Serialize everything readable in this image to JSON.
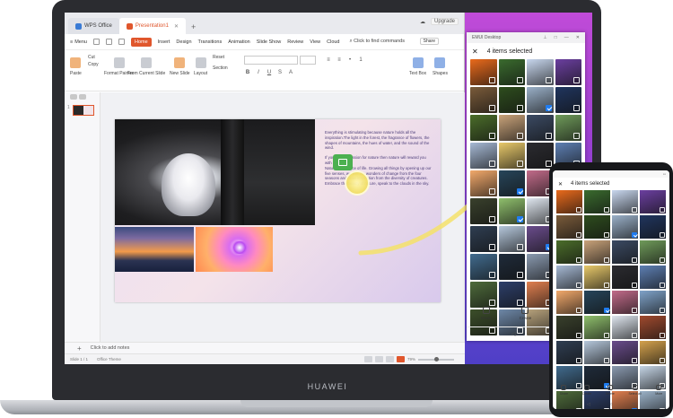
{
  "laptop": {
    "brand": "HUAWEI"
  },
  "wps": {
    "tabs": [
      {
        "label": "WPS Office"
      },
      {
        "label": "Presentation1"
      }
    ],
    "title_right": {
      "upgrade": "Upgrade"
    },
    "menu": {
      "menu_label": "Menu",
      "items": [
        "Home",
        "Insert",
        "Design",
        "Transitions",
        "Animation",
        "Slide Show",
        "Review",
        "View",
        "Cloud"
      ],
      "command_search": "Click to find commands",
      "share": "Share"
    },
    "ribbon": {
      "paste": "Paste",
      "cut": "Cut",
      "copy": "Copy",
      "format_painter": "Format Painter",
      "from_current_slide": "From Current Slide",
      "new_slide": "New Slide",
      "layout": "Layout",
      "reset": "Reset",
      "section": "Section",
      "text_box": "Text Box",
      "shapes": "Shapes"
    },
    "slide": {
      "paragraph1": "Everything is stimulating because nature holds all the inspiration.The light in the forest, the fragrance of flowers, the shapes of mountains, the hues of water, and the sound of the wind.",
      "paragraph2": "If you have a passion for nature then nature will reward you with love.",
      "paragraph3": "Nature is a source of life. Growing all things by opening up our five senses, we feel the wonders of change from the four seasons and draw inspiration from the diversity of creatures.",
      "paragraph4": "Embrace the beauty of nature, speak to the clouds in the sky."
    },
    "thumbs": {
      "slide_number": "1"
    },
    "notes_placeholder": "Click to add notes",
    "status": {
      "slide_info": "Slide 1 / 1",
      "theme": "Office Theme",
      "zoom": "79%"
    }
  },
  "emui": {
    "window_title": "EMUI Desktop",
    "selection_title": "4 items selected",
    "actions": [
      "Share",
      "Create",
      "Delete"
    ],
    "checked_indices": [
      6,
      17,
      21,
      26
    ],
    "colors": [
      "#e96a1c",
      "#3a6b2e",
      "#c8d7ee",
      "#6b3fa0",
      "#7a5b3a",
      "#2e4d1e",
      "#9ab0c8",
      "#20355e",
      "#4b6d2a",
      "#c9a37a",
      "#3b4a63",
      "#6f9b5a",
      "#a6b9d4",
      "#e8c96a",
      "#2b2b30",
      "#5d7fb3",
      "#f2a96b",
      "#27455a",
      "#c26b8a",
      "#7fa3c9",
      "#39402c",
      "#8fbf6c",
      "#dfe6ef",
      "#a04a2e",
      "#2f3e52",
      "#b5c7db",
      "#6a4c8c",
      "#d4a24c",
      "#416b8e",
      "#1f2b3a",
      "#8a9ab0",
      "#c5d5e6",
      "#4e6b3b",
      "#2d3f6a",
      "#e07f4f",
      "#9cb3c9",
      "#3c4f2a",
      "#6e88a8",
      "#b7a27c",
      "#253445"
    ]
  },
  "phone": {
    "selection_title": "4 items selected",
    "actions": [
      "Share",
      "Create",
      "Delete",
      "Select all",
      "More"
    ],
    "checked_indices": [
      6,
      17,
      29,
      34
    ],
    "colors": [
      "#e96a1c",
      "#3a6b2e",
      "#c8d7ee",
      "#6b3fa0",
      "#7a5b3a",
      "#2e4d1e",
      "#9ab0c8",
      "#20355e",
      "#4b6d2a",
      "#c9a37a",
      "#3b4a63",
      "#6f9b5a",
      "#a6b9d4",
      "#e8c96a",
      "#2b2b30",
      "#5d7fb3",
      "#f2a96b",
      "#27455a",
      "#c26b8a",
      "#7fa3c9",
      "#39402c",
      "#8fbf6c",
      "#dfe6ef",
      "#a04a2e",
      "#2f3e52",
      "#b5c7db",
      "#6a4c8c",
      "#d4a24c",
      "#416b8e",
      "#1f2b3a",
      "#8a9ab0",
      "#c5d5e6",
      "#4e6b3b",
      "#2d3f6a",
      "#e07f4f",
      "#9cb3c9"
    ]
  },
  "colors": {
    "wps_accent": "#e0562c",
    "select_blue": "#1f7cf0",
    "drag_yellow": "#f4e26a"
  }
}
